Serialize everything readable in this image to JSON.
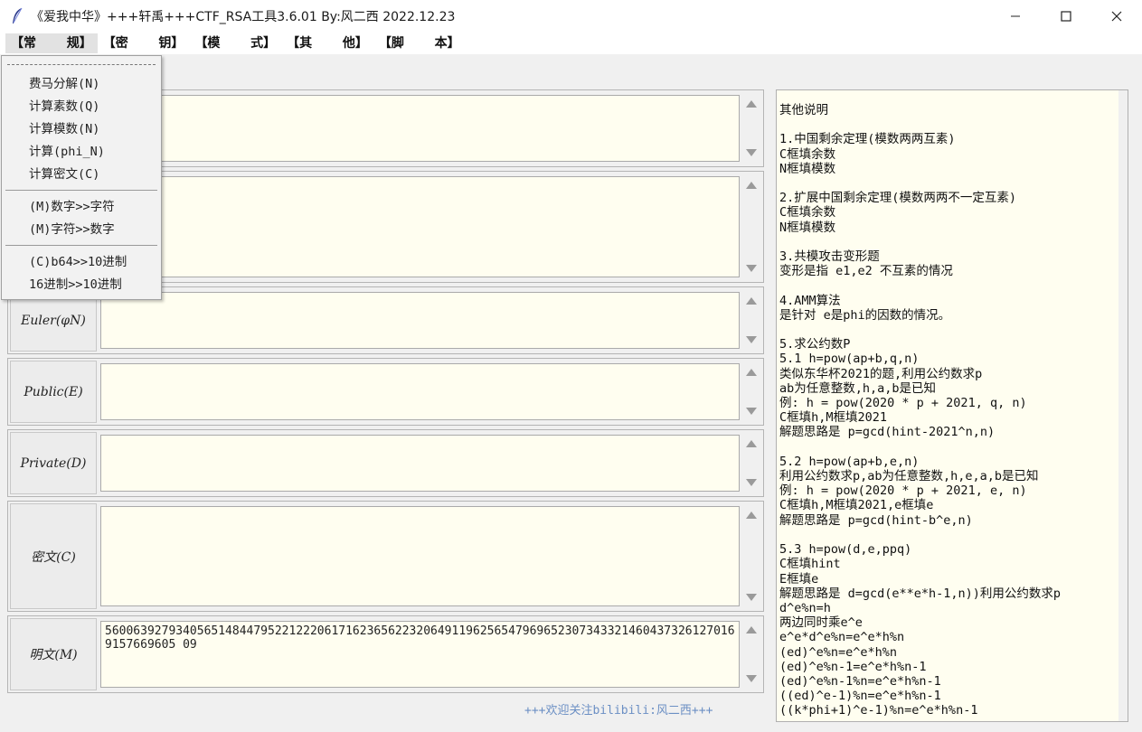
{
  "window": {
    "title": "《爱我中华》+++轩禹+++CTF_RSA工具3.6.01   By:风二西 2022.12.23"
  },
  "menu": [
    {
      "label": "【常    规】"
    },
    {
      "label": "【密    钥】"
    },
    {
      "label": "【模    式】"
    },
    {
      "label": "【其    他】"
    },
    {
      "label": "【脚    本】"
    }
  ],
  "dropdown": {
    "group1": [
      "费马分解(N)",
      "计算素数(Q)",
      "计算模数(N)",
      "计算(phi_N)",
      "计算密文(C)"
    ],
    "group2": [
      "(M)数字>>字符",
      "(M)字符>>数字"
    ],
    "group3": [
      "(C)b64>>10进制",
      "16进制>>10进制"
    ]
  },
  "rows": [
    {
      "label": "",
      "value": ""
    },
    {
      "label": "",
      "value": ""
    },
    {
      "label": "Euler(φN)",
      "value": ""
    },
    {
      "label": "Public(E)",
      "value": ""
    },
    {
      "label": "Private(D)",
      "value": ""
    },
    {
      "label": "密文(C)",
      "value": ""
    },
    {
      "label": "明文(M)",
      "value": "560063927934056514844795221222061716236562232064911962565479696523073433214604373261270169157669605 09"
    }
  ],
  "notes": "其他说明\n\n1.中国剩余定理(模数两两互素)\nC框填余数\nN框填模数\n\n2.扩展中国剩余定理(模数两两不一定互素)\nC框填余数\nN框填模数\n\n3.共模攻击变形题\n变形是指 e1,e2 不互素的情况\n\n4.AMM算法\n是针对 e是phi的因数的情况。\n\n5.求公约数P\n5.1 h=pow(ap+b,q,n)\n类似东华杯2021的题,利用公约数求p\nab为任意整数,h,a,b是已知\n例: h = pow(2020 * p + 2021, q, n)\nC框填h,M框填2021\n解题思路是 p=gcd(hint-2021^n,n)\n\n5.2 h=pow(ap+b,e,n)\n利用公约数求p,ab为任意整数,h,e,a,b是已知\n例: h = pow(2020 * p + 2021, e, n)\nC框填h,M框填2021,e框填e\n解题思路是 p=gcd(hint-b^e,n)\n\n5.3 h=pow(d,e,ppq)\nC框填hint\nE框填e\n解题思路是 d=gcd(e**e*h-1,n))利用公约数求p\nd^e%n=h\n两边同时乘e^e\ne^e*d^e%n=e^e*h%n\n(ed)^e%n=e^e*h%n\n(ed)^e%n-1=e^e*h%n-1\n(ed)^e%n-1%n=e^e*h%n-1\n((ed)^e-1)%n=e^e*h%n-1\n((k*phi+1)^e-1)%n=e^e*h%n-1",
  "footer": "+++欢迎关注bilibili:风二西+++"
}
